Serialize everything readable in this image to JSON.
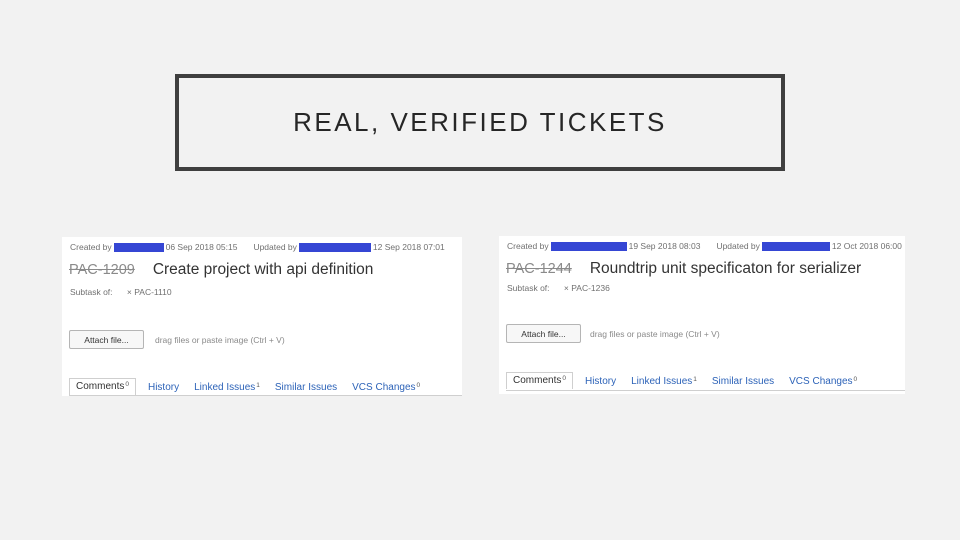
{
  "slide": {
    "title": "REAL, VERIFIED TICKETS"
  },
  "tickets": [
    {
      "created_label": "Created by",
      "created_date": "06 Sep 2018 05:15",
      "updated_label": "Updated by",
      "updated_date": "12 Sep 2018 07:01",
      "key": "PAC-1209",
      "summary": "Create project with api definition",
      "subtask_label": "Subtask of:",
      "parent": "× PAC-1110",
      "attach_label": "Attach file...",
      "drop_hint": "drag files or paste image (Ctrl + V)",
      "tabs": [
        {
          "label": "Comments",
          "count": "0"
        },
        {
          "label": "History",
          "count": ""
        },
        {
          "label": "Linked Issues",
          "count": "1"
        },
        {
          "label": "Similar Issues",
          "count": ""
        },
        {
          "label": "VCS Changes",
          "count": "0"
        }
      ]
    },
    {
      "created_label": "Created by",
      "created_date": "19 Sep 2018 08:03",
      "updated_label": "Updated by",
      "updated_date": "12 Oct 2018 06:00",
      "key": "PAC-1244",
      "summary": "Roundtrip unit specificaton for serializer",
      "subtask_label": "Subtask of:",
      "parent": "× PAC-1236",
      "attach_label": "Attach file...",
      "drop_hint": "drag files or paste image (Ctrl + V)",
      "tabs": [
        {
          "label": "Comments",
          "count": "0"
        },
        {
          "label": "History",
          "count": ""
        },
        {
          "label": "Linked Issues",
          "count": "1"
        },
        {
          "label": "Similar Issues",
          "count": ""
        },
        {
          "label": "VCS Changes",
          "count": "0"
        }
      ]
    }
  ],
  "colors": {
    "redaction": "#3546d4",
    "link": "#2d63b8",
    "frame": "#3f3f3f"
  }
}
